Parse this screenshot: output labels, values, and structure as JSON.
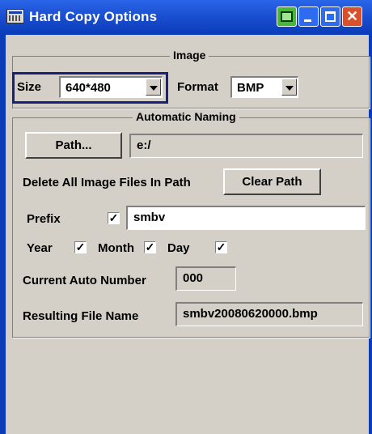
{
  "window": {
    "title": "Hard Copy Options",
    "icon": "printer-dialog-icon",
    "title_buttons": [
      "print-icon",
      "minimize-icon",
      "maximize-icon",
      "close-icon"
    ]
  },
  "image_group": {
    "title": "Image",
    "size_label": "Size",
    "size_value": "640*480",
    "format_label": "Format",
    "format_value": "BMP"
  },
  "naming_group": {
    "title": "Automatic Naming",
    "path_button": "Path...",
    "path_value": "e:/",
    "delete_label": "Delete All Image Files In Path",
    "clear_path_button": "Clear Path",
    "prefix_label": "Prefix",
    "prefix_checked": true,
    "prefix_value": "smbv",
    "year_label": "Year",
    "year_checked": true,
    "month_label": "Month",
    "month_checked": true,
    "day_label": "Day",
    "day_checked": true,
    "checkmark": "✓",
    "auto_number_label": "Current Auto Number",
    "auto_number_value": "000",
    "result_label": "Resulting File Name",
    "result_value": "smbv20080620000.bmp"
  },
  "colors": {
    "titlebar": "#1b4fd1",
    "dialog_bg": "#d4d0c8",
    "focus_border": "#18207e",
    "close_button": "#d9512c",
    "print_button": "#46b83a"
  }
}
